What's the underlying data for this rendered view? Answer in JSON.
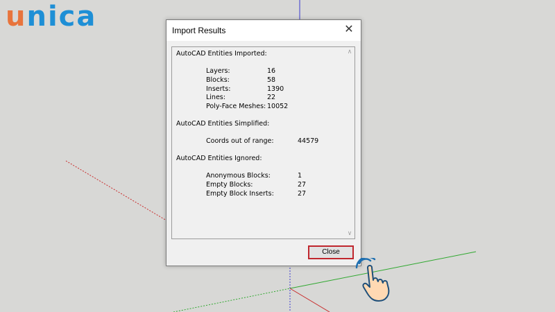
{
  "branding": {
    "logo_u": "u",
    "logo_rest": "nica",
    "accent_orange": "#e8743c",
    "accent_blue": "#1e8fd6"
  },
  "dialog": {
    "title": "Import Results",
    "close_icon": "close-icon",
    "close_button_label": "Close",
    "sections": {
      "imported": {
        "title": "AutoCAD Entities Imported:",
        "rows": [
          {
            "label": "Layers:",
            "value": "16"
          },
          {
            "label": "Blocks:",
            "value": "58"
          },
          {
            "label": "Inserts:",
            "value": "1390"
          },
          {
            "label": "Lines:",
            "value": "22"
          },
          {
            "label": "Poly-Face Meshes:",
            "value": "10052"
          }
        ]
      },
      "simplified": {
        "title": "AutoCAD Entities Simplified:",
        "rows": [
          {
            "label": "Coords out of range:",
            "value": "44579"
          }
        ]
      },
      "ignored": {
        "title": "AutoCAD Entities Ignored:",
        "rows": [
          {
            "label": "Anonymous Blocks:",
            "value": "1"
          },
          {
            "label": "Empty Blocks:",
            "value": "27"
          },
          {
            "label": "Empty Block Inserts:",
            "value": "27"
          }
        ]
      }
    }
  }
}
